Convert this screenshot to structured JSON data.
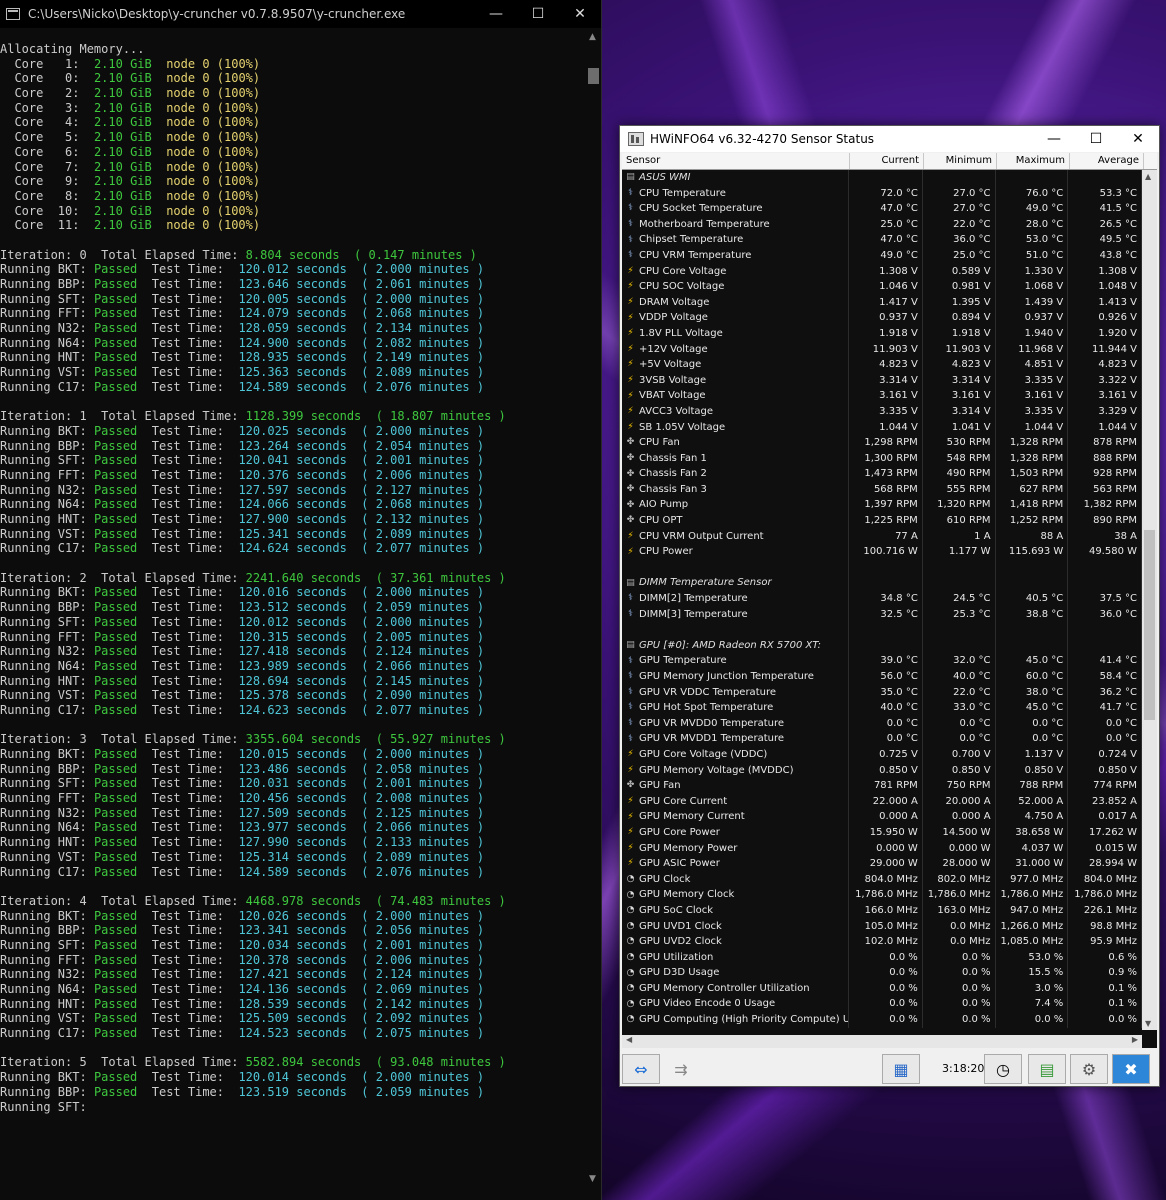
{
  "console": {
    "title": "C:\\Users\\Nicko\\Desktop\\y-cruncher v0.7.8.9507\\y-cruncher.exe",
    "allocating": "Allocating Memory...",
    "cores": [
      {
        "id": "1",
        "size": "2.10 GiB",
        "node": "node 0 (100%)"
      },
      {
        "id": "0",
        "size": "2.10 GiB",
        "node": "node 0 (100%)"
      },
      {
        "id": "2",
        "size": "2.10 GiB",
        "node": "node 0 (100%)"
      },
      {
        "id": "3",
        "size": "2.10 GiB",
        "node": "node 0 (100%)"
      },
      {
        "id": "4",
        "size": "2.10 GiB",
        "node": "node 0 (100%)"
      },
      {
        "id": "5",
        "size": "2.10 GiB",
        "node": "node 0 (100%)"
      },
      {
        "id": "6",
        "size": "2.10 GiB",
        "node": "node 0 (100%)"
      },
      {
        "id": "7",
        "size": "2.10 GiB",
        "node": "node 0 (100%)"
      },
      {
        "id": "9",
        "size": "2.10 GiB",
        "node": "node 0 (100%)"
      },
      {
        "id": "8",
        "size": "2.10 GiB",
        "node": "node 0 (100%)"
      },
      {
        "id": "10",
        "size": "2.10 GiB",
        "node": "node 0 (100%)"
      },
      {
        "id": "11",
        "size": "2.10 GiB",
        "node": "node 0 (100%)"
      }
    ],
    "iterations": [
      {
        "n": "0",
        "elapsed": "8.804 seconds",
        "elapsed_min": "( 0.147 minutes )",
        "tests": [
          {
            "name": "BKT",
            "status": "Passed",
            "time": "120.012 seconds",
            "min": "( 2.000 minutes )"
          },
          {
            "name": "BBP",
            "status": "Passed",
            "time": "123.646 seconds",
            "min": "( 2.061 minutes )"
          },
          {
            "name": "SFT",
            "status": "Passed",
            "time": "120.005 seconds",
            "min": "( 2.000 minutes )"
          },
          {
            "name": "FFT",
            "status": "Passed",
            "time": "124.079 seconds",
            "min": "( 2.068 minutes )"
          },
          {
            "name": "N32",
            "status": "Passed",
            "time": "128.059 seconds",
            "min": "( 2.134 minutes )"
          },
          {
            "name": "N64",
            "status": "Passed",
            "time": "124.900 seconds",
            "min": "( 2.082 minutes )"
          },
          {
            "name": "HNT",
            "status": "Passed",
            "time": "128.935 seconds",
            "min": "( 2.149 minutes )"
          },
          {
            "name": "VST",
            "status": "Passed",
            "time": "125.363 seconds",
            "min": "( 2.089 minutes )"
          },
          {
            "name": "C17",
            "status": "Passed",
            "time": "124.589 seconds",
            "min": "( 2.076 minutes )"
          }
        ]
      },
      {
        "n": "1",
        "elapsed": "1128.399 seconds",
        "elapsed_min": "( 18.807 minutes )",
        "tests": [
          {
            "name": "BKT",
            "status": "Passed",
            "time": "120.025 seconds",
            "min": "( 2.000 minutes )"
          },
          {
            "name": "BBP",
            "status": "Passed",
            "time": "123.264 seconds",
            "min": "( 2.054 minutes )"
          },
          {
            "name": "SFT",
            "status": "Passed",
            "time": "120.041 seconds",
            "min": "( 2.001 minutes )"
          },
          {
            "name": "FFT",
            "status": "Passed",
            "time": "120.376 seconds",
            "min": "( 2.006 minutes )"
          },
          {
            "name": "N32",
            "status": "Passed",
            "time": "127.597 seconds",
            "min": "( 2.127 minutes )"
          },
          {
            "name": "N64",
            "status": "Passed",
            "time": "124.066 seconds",
            "min": "( 2.068 minutes )"
          },
          {
            "name": "HNT",
            "status": "Passed",
            "time": "127.900 seconds",
            "min": "( 2.132 minutes )"
          },
          {
            "name": "VST",
            "status": "Passed",
            "time": "125.341 seconds",
            "min": "( 2.089 minutes )"
          },
          {
            "name": "C17",
            "status": "Passed",
            "time": "124.624 seconds",
            "min": "( 2.077 minutes )"
          }
        ]
      },
      {
        "n": "2",
        "elapsed": "2241.640 seconds",
        "elapsed_min": "( 37.361 minutes )",
        "tests": [
          {
            "name": "BKT",
            "status": "Passed",
            "time": "120.016 seconds",
            "min": "( 2.000 minutes )"
          },
          {
            "name": "BBP",
            "status": "Passed",
            "time": "123.512 seconds",
            "min": "( 2.059 minutes )"
          },
          {
            "name": "SFT",
            "status": "Passed",
            "time": "120.012 seconds",
            "min": "( 2.000 minutes )"
          },
          {
            "name": "FFT",
            "status": "Passed",
            "time": "120.315 seconds",
            "min": "( 2.005 minutes )"
          },
          {
            "name": "N32",
            "status": "Passed",
            "time": "127.418 seconds",
            "min": "( 2.124 minutes )"
          },
          {
            "name": "N64",
            "status": "Passed",
            "time": "123.989 seconds",
            "min": "( 2.066 minutes )"
          },
          {
            "name": "HNT",
            "status": "Passed",
            "time": "128.694 seconds",
            "min": "( 2.145 minutes )"
          },
          {
            "name": "VST",
            "status": "Passed",
            "time": "125.378 seconds",
            "min": "( 2.090 minutes )"
          },
          {
            "name": "C17",
            "status": "Passed",
            "time": "124.623 seconds",
            "min": "( 2.077 minutes )"
          }
        ]
      },
      {
        "n": "3",
        "elapsed": "3355.604 seconds",
        "elapsed_min": "( 55.927 minutes )",
        "tests": [
          {
            "name": "BKT",
            "status": "Passed",
            "time": "120.015 seconds",
            "min": "( 2.000 minutes )"
          },
          {
            "name": "BBP",
            "status": "Passed",
            "time": "123.486 seconds",
            "min": "( 2.058 minutes )"
          },
          {
            "name": "SFT",
            "status": "Passed",
            "time": "120.031 seconds",
            "min": "( 2.001 minutes )"
          },
          {
            "name": "FFT",
            "status": "Passed",
            "time": "120.456 seconds",
            "min": "( 2.008 minutes )"
          },
          {
            "name": "N32",
            "status": "Passed",
            "time": "127.509 seconds",
            "min": "( 2.125 minutes )"
          },
          {
            "name": "N64",
            "status": "Passed",
            "time": "123.977 seconds",
            "min": "( 2.066 minutes )"
          },
          {
            "name": "HNT",
            "status": "Passed",
            "time": "127.990 seconds",
            "min": "( 2.133 minutes )"
          },
          {
            "name": "VST",
            "status": "Passed",
            "time": "125.314 seconds",
            "min": "( 2.089 minutes )"
          },
          {
            "name": "C17",
            "status": "Passed",
            "time": "124.589 seconds",
            "min": "( 2.076 minutes )"
          }
        ]
      },
      {
        "n": "4",
        "elapsed": "4468.978 seconds",
        "elapsed_min": "( 74.483 minutes )",
        "tests": [
          {
            "name": "BKT",
            "status": "Passed",
            "time": "120.026 seconds",
            "min": "( 2.000 minutes )"
          },
          {
            "name": "BBP",
            "status": "Passed",
            "time": "123.341 seconds",
            "min": "( 2.056 minutes )"
          },
          {
            "name": "SFT",
            "status": "Passed",
            "time": "120.034 seconds",
            "min": "( 2.001 minutes )"
          },
          {
            "name": "FFT",
            "status": "Passed",
            "time": "120.378 seconds",
            "min": "( 2.006 minutes )"
          },
          {
            "name": "N32",
            "status": "Passed",
            "time": "127.421 seconds",
            "min": "( 2.124 minutes )"
          },
          {
            "name": "N64",
            "status": "Passed",
            "time": "124.136 seconds",
            "min": "( 2.069 minutes )"
          },
          {
            "name": "HNT",
            "status": "Passed",
            "time": "128.539 seconds",
            "min": "( 2.142 minutes )"
          },
          {
            "name": "VST",
            "status": "Passed",
            "time": "125.509 seconds",
            "min": "( 2.092 minutes )"
          },
          {
            "name": "C17",
            "status": "Passed",
            "time": "124.523 seconds",
            "min": "( 2.075 minutes )"
          }
        ]
      },
      {
        "n": "5",
        "elapsed": "5582.894 seconds",
        "elapsed_min": "( 93.048 minutes )",
        "tests": [
          {
            "name": "BKT",
            "status": "Passed",
            "time": "120.014 seconds",
            "min": "( 2.000 minutes )"
          },
          {
            "name": "BBP",
            "status": "Passed",
            "time": "123.519 seconds",
            "min": "( 2.059 minutes )"
          },
          {
            "name": "SFT",
            "status": "",
            "time": "",
            "min": ""
          }
        ]
      }
    ]
  },
  "hwinfo": {
    "title": "HWiNFO64 v6.32-4270 Sensor Status",
    "columns": [
      "Sensor",
      "Current",
      "Minimum",
      "Maximum",
      "Average"
    ],
    "rows": [
      {
        "type": "section",
        "icon": "chip",
        "name": "ASUS WMI"
      },
      {
        "icon": "therm",
        "name": "CPU Temperature",
        "cur": "72.0 °C",
        "min": "27.0 °C",
        "max": "76.0 °C",
        "avg": "53.3 °C"
      },
      {
        "icon": "therm",
        "name": "CPU Socket Temperature",
        "cur": "47.0 °C",
        "min": "27.0 °C",
        "max": "49.0 °C",
        "avg": "41.5 °C"
      },
      {
        "icon": "therm",
        "name": "Motherboard Temperature",
        "cur": "25.0 °C",
        "min": "22.0 °C",
        "max": "28.0 °C",
        "avg": "26.5 °C"
      },
      {
        "icon": "therm",
        "name": "Chipset Temperature",
        "cur": "47.0 °C",
        "min": "36.0 °C",
        "max": "53.0 °C",
        "avg": "49.5 °C"
      },
      {
        "icon": "therm",
        "name": "CPU VRM Temperature",
        "cur": "49.0 °C",
        "min": "25.0 °C",
        "max": "51.0 °C",
        "avg": "43.8 °C"
      },
      {
        "icon": "volt",
        "name": "CPU Core Voltage",
        "cur": "1.308 V",
        "min": "0.589 V",
        "max": "1.330 V",
        "avg": "1.308 V"
      },
      {
        "icon": "volt",
        "name": "CPU SOC Voltage",
        "cur": "1.046 V",
        "min": "0.981 V",
        "max": "1.068 V",
        "avg": "1.048 V"
      },
      {
        "icon": "volt",
        "name": "DRAM Voltage",
        "cur": "1.417 V",
        "min": "1.395 V",
        "max": "1.439 V",
        "avg": "1.413 V"
      },
      {
        "icon": "volt",
        "name": "VDDP Voltage",
        "cur": "0.937 V",
        "min": "0.894 V",
        "max": "0.937 V",
        "avg": "0.926 V"
      },
      {
        "icon": "volt",
        "name": "1.8V PLL Voltage",
        "cur": "1.918 V",
        "min": "1.918 V",
        "max": "1.940 V",
        "avg": "1.920 V"
      },
      {
        "icon": "volt",
        "name": "+12V Voltage",
        "cur": "11.903 V",
        "min": "11.903 V",
        "max": "11.968 V",
        "avg": "11.944 V"
      },
      {
        "icon": "volt",
        "name": "+5V Voltage",
        "cur": "4.823 V",
        "min": "4.823 V",
        "max": "4.851 V",
        "avg": "4.823 V"
      },
      {
        "icon": "volt",
        "name": "3VSB Voltage",
        "cur": "3.314 V",
        "min": "3.314 V",
        "max": "3.335 V",
        "avg": "3.322 V"
      },
      {
        "icon": "volt",
        "name": "VBAT Voltage",
        "cur": "3.161 V",
        "min": "3.161 V",
        "max": "3.161 V",
        "avg": "3.161 V"
      },
      {
        "icon": "volt",
        "name": "AVCC3 Voltage",
        "cur": "3.335 V",
        "min": "3.314 V",
        "max": "3.335 V",
        "avg": "3.329 V"
      },
      {
        "icon": "volt",
        "name": "SB 1.05V Voltage",
        "cur": "1.044 V",
        "min": "1.041 V",
        "max": "1.044 V",
        "avg": "1.044 V"
      },
      {
        "icon": "fan",
        "name": "CPU Fan",
        "cur": "1,298 RPM",
        "min": "530 RPM",
        "max": "1,328 RPM",
        "avg": "878 RPM"
      },
      {
        "icon": "fan",
        "name": "Chassis Fan 1",
        "cur": "1,300 RPM",
        "min": "548 RPM",
        "max": "1,328 RPM",
        "avg": "888 RPM"
      },
      {
        "icon": "fan",
        "name": "Chassis Fan 2",
        "cur": "1,473 RPM",
        "min": "490 RPM",
        "max": "1,503 RPM",
        "avg": "928 RPM"
      },
      {
        "icon": "fan",
        "name": "Chassis Fan 3",
        "cur": "568 RPM",
        "min": "555 RPM",
        "max": "627 RPM",
        "avg": "563 RPM"
      },
      {
        "icon": "fan",
        "name": "AIO Pump",
        "cur": "1,397 RPM",
        "min": "1,320 RPM",
        "max": "1,418 RPM",
        "avg": "1,382 RPM"
      },
      {
        "icon": "fan",
        "name": "CPU OPT",
        "cur": "1,225 RPM",
        "min": "610 RPM",
        "max": "1,252 RPM",
        "avg": "890 RPM"
      },
      {
        "icon": "volt",
        "name": "CPU VRM Output Current",
        "cur": "77 A",
        "min": "1 A",
        "max": "88 A",
        "avg": "38 A"
      },
      {
        "icon": "volt",
        "name": "CPU Power",
        "cur": "100.716 W",
        "min": "1.177 W",
        "max": "115.693 W",
        "avg": "49.580 W"
      },
      {
        "type": "blank"
      },
      {
        "type": "section",
        "icon": "chip",
        "name": "DIMM Temperature Sensor"
      },
      {
        "icon": "therm",
        "name": "DIMM[2] Temperature",
        "cur": "34.8 °C",
        "min": "24.5 °C",
        "max": "40.5 °C",
        "avg": "37.5 °C"
      },
      {
        "icon": "therm",
        "name": "DIMM[3] Temperature",
        "cur": "32.5 °C",
        "min": "25.3 °C",
        "max": "38.8 °C",
        "avg": "36.0 °C"
      },
      {
        "type": "blank"
      },
      {
        "type": "section",
        "icon": "chip",
        "name": "GPU [#0]: AMD Radeon RX 5700 XT:"
      },
      {
        "icon": "therm",
        "name": "GPU Temperature",
        "cur": "39.0 °C",
        "min": "32.0 °C",
        "max": "45.0 °C",
        "avg": "41.4 °C"
      },
      {
        "icon": "therm",
        "name": "GPU Memory Junction Temperature",
        "cur": "56.0 °C",
        "min": "40.0 °C",
        "max": "60.0 °C",
        "avg": "58.4 °C"
      },
      {
        "icon": "therm",
        "name": "GPU VR VDDC Temperature",
        "cur": "35.0 °C",
        "min": "22.0 °C",
        "max": "38.0 °C",
        "avg": "36.2 °C"
      },
      {
        "icon": "therm",
        "name": "GPU Hot Spot Temperature",
        "cur": "40.0 °C",
        "min": "33.0 °C",
        "max": "45.0 °C",
        "avg": "41.7 °C"
      },
      {
        "icon": "therm",
        "name": "GPU VR MVDD0 Temperature",
        "cur": "0.0 °C",
        "min": "0.0 °C",
        "max": "0.0 °C",
        "avg": "0.0 °C"
      },
      {
        "icon": "therm",
        "name": "GPU VR MVDD1 Temperature",
        "cur": "0.0 °C",
        "min": "0.0 °C",
        "max": "0.0 °C",
        "avg": "0.0 °C"
      },
      {
        "icon": "volt",
        "name": "GPU Core Voltage (VDDC)",
        "cur": "0.725 V",
        "min": "0.700 V",
        "max": "1.137 V",
        "avg": "0.724 V"
      },
      {
        "icon": "volt",
        "name": "GPU Memory Voltage (MVDDC)",
        "cur": "0.850 V",
        "min": "0.850 V",
        "max": "0.850 V",
        "avg": "0.850 V"
      },
      {
        "icon": "fan",
        "name": "GPU Fan",
        "cur": "781 RPM",
        "min": "750 RPM",
        "max": "788 RPM",
        "avg": "774 RPM"
      },
      {
        "icon": "volt",
        "name": "GPU Core Current",
        "cur": "22.000 A",
        "min": "20.000 A",
        "max": "52.000 A",
        "avg": "23.852 A"
      },
      {
        "icon": "volt",
        "name": "GPU Memory Current",
        "cur": "0.000 A",
        "min": "0.000 A",
        "max": "4.750 A",
        "avg": "0.017 A"
      },
      {
        "icon": "volt",
        "name": "GPU Core Power",
        "cur": "15.950 W",
        "min": "14.500 W",
        "max": "38.658 W",
        "avg": "17.262 W"
      },
      {
        "icon": "volt",
        "name": "GPU Memory Power",
        "cur": "0.000 W",
        "min": "0.000 W",
        "max": "4.037 W",
        "avg": "0.015 W"
      },
      {
        "icon": "volt",
        "name": "GPU ASIC Power",
        "cur": "29.000 W",
        "min": "28.000 W",
        "max": "31.000 W",
        "avg": "28.994 W"
      },
      {
        "icon": "clock",
        "name": "GPU Clock",
        "cur": "804.0 MHz",
        "min": "802.0 MHz",
        "max": "977.0 MHz",
        "avg": "804.0 MHz"
      },
      {
        "icon": "clock",
        "name": "GPU Memory Clock",
        "cur": "1,786.0 MHz",
        "min": "1,786.0 MHz",
        "max": "1,786.0 MHz",
        "avg": "1,786.0 MHz"
      },
      {
        "icon": "clock",
        "name": "GPU SoC Clock",
        "cur": "166.0 MHz",
        "min": "163.0 MHz",
        "max": "947.0 MHz",
        "avg": "226.1 MHz"
      },
      {
        "icon": "clock",
        "name": "GPU UVD1 Clock",
        "cur": "105.0 MHz",
        "min": "0.0 MHz",
        "max": "1,266.0 MHz",
        "avg": "98.8 MHz"
      },
      {
        "icon": "clock",
        "name": "GPU UVD2 Clock",
        "cur": "102.0 MHz",
        "min": "0.0 MHz",
        "max": "1,085.0 MHz",
        "avg": "95.9 MHz"
      },
      {
        "icon": "clock",
        "name": "GPU Utilization",
        "cur": "0.0 %",
        "min": "0.0 %",
        "max": "53.0 %",
        "avg": "0.6 %"
      },
      {
        "icon": "clock",
        "name": "GPU D3D Usage",
        "cur": "0.0 %",
        "min": "0.0 %",
        "max": "15.5 %",
        "avg": "0.9 %"
      },
      {
        "icon": "clock",
        "name": "GPU Memory Controller Utilization",
        "cur": "0.0 %",
        "min": "0.0 %",
        "max": "3.0 %",
        "avg": "0.1 %"
      },
      {
        "icon": "clock",
        "name": "GPU Video Encode 0 Usage",
        "cur": "0.0 %",
        "min": "0.0 %",
        "max": "7.4 %",
        "avg": "0.1 %"
      },
      {
        "icon": "clock",
        "name": "GPU Computing (High Priority Compute) Usage",
        "cur": "0.0 %",
        "min": "0.0 %",
        "max": "0.0 %",
        "avg": "0.0 %"
      }
    ],
    "toolbar_time": "3:18:20"
  }
}
